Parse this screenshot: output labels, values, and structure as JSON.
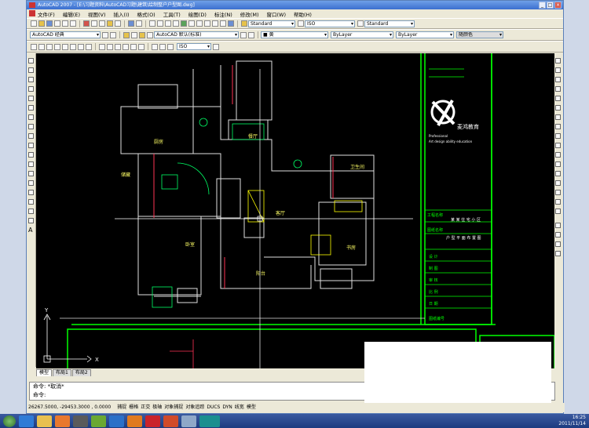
{
  "window": {
    "title": "AutoCAD 2007 - [E:\\习题资料\\AutoCAD习题\\建筑\\绘制整户户型图.dwg]"
  },
  "menu": [
    "文件(F)",
    "编辑(E)",
    "视图(V)",
    "插入(I)",
    "格式(O)",
    "工具(T)",
    "绘图(D)",
    "标注(N)",
    "修改(M)",
    "窗口(W)",
    "帮助(H)"
  ],
  "toolbar": {
    "text_style": "Standard",
    "dim_style": "ISO",
    "table_style": "Standard",
    "workspace": "AutoCAD 经典",
    "layer_state": "AutoCAD 默认(标准)",
    "color": "■ 黄",
    "linetype": "ByLayer",
    "lineweight": "ByLayer",
    "plotstyle": "随颜色",
    "dim_combo": "ISO"
  },
  "drawing": {
    "rooms": {
      "kitchen": "厨房",
      "dining": "餐厅",
      "living": "客厅",
      "bedroom": "卧室",
      "balcony": "阳台",
      "bath": "卫生间",
      "store": "储藏",
      "study": "书房"
    },
    "logo_text": "麦鸿教育",
    "logo_sub1": "Professional",
    "logo_sub2": "Art design ability education",
    "titleblock": {
      "row1": "工程名称",
      "row1_val": "某 某 住 宅 小 区",
      "row2": "图纸名称",
      "row2_val": "户 型 平 面 布 置 图",
      "label_design": "设 计",
      "label_draw": "制 图",
      "label_check": "审 核",
      "label_scale": "比 例",
      "label_date": "日 期",
      "label_no": "图纸编号"
    }
  },
  "ucs": {
    "x": "X",
    "y": "Y"
  },
  "tabs": [
    "模型",
    "布局1",
    "布局2"
  ],
  "command": {
    "line1": "命令: *取消*",
    "line2": "命令:"
  },
  "status": {
    "coords": "26267.5000, -29453.3000 , 0.0000",
    "buttons": [
      "捕捉",
      "栅格",
      "正交",
      "极轴",
      "对象捕捉",
      "对象追踪",
      "DUCS",
      "DYN",
      "线宽",
      "模型"
    ]
  },
  "taskbar": {
    "time": "16:25",
    "date": "2011/11/14"
  }
}
